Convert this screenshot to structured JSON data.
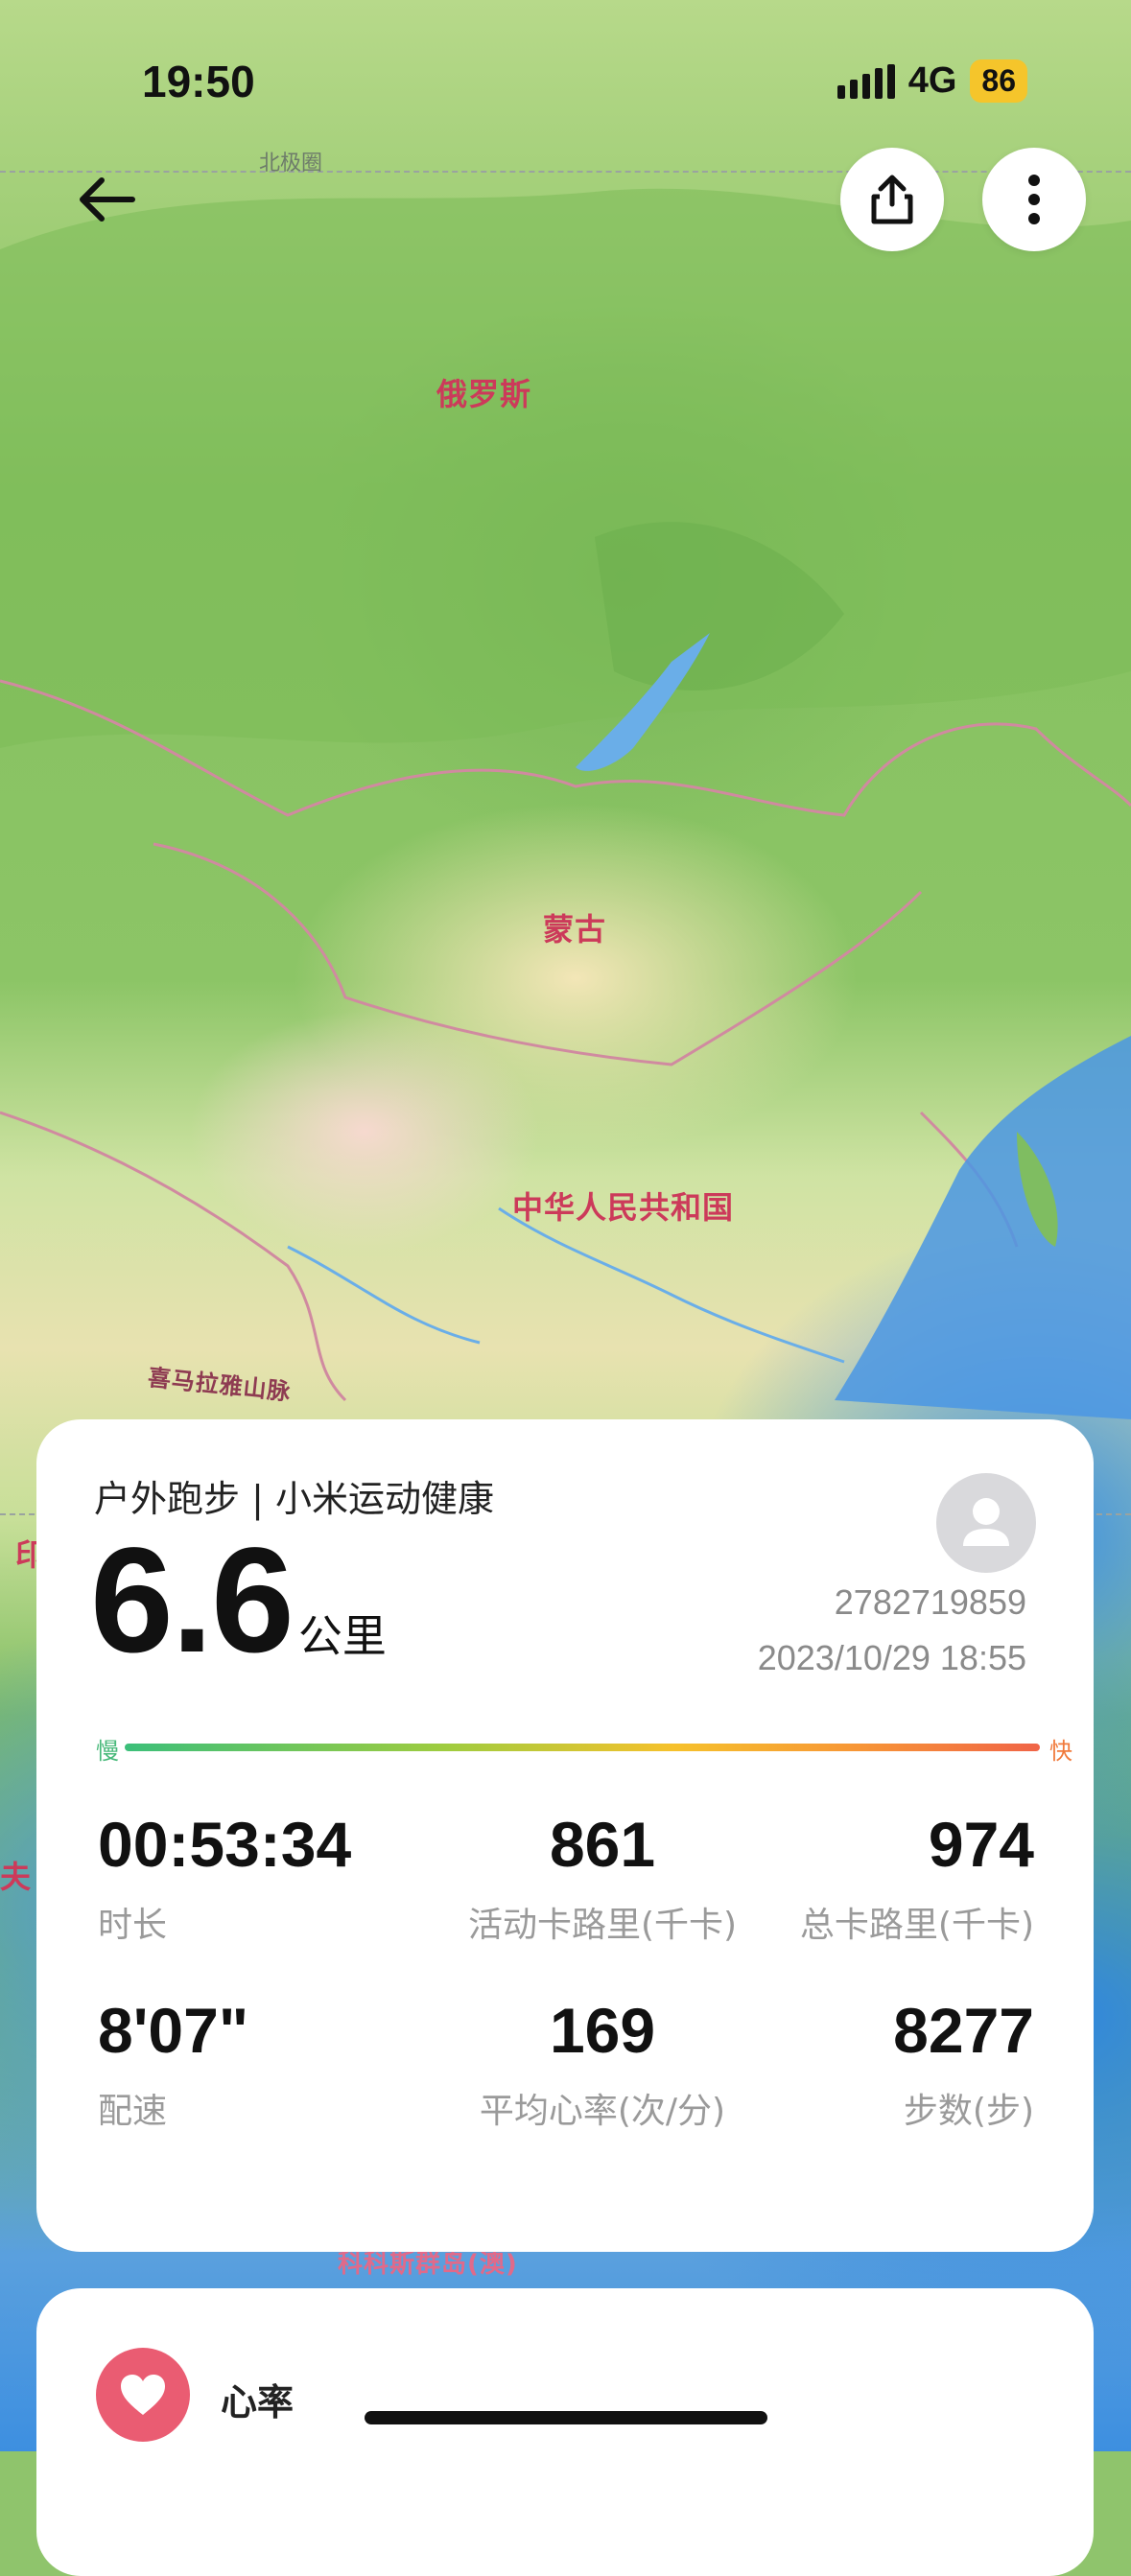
{
  "status_bar": {
    "time": "19:50",
    "network": "4G",
    "battery": "86"
  },
  "map": {
    "labels": {
      "arctic_circle": "北极圈",
      "russia": "俄罗斯",
      "mongolia": "蒙古",
      "china": "中华人民共和国",
      "himalaya": "喜马拉雅山脉",
      "india_partial": "印",
      "left_partial": "夫",
      "cocos": "科科斯群岛(澳)"
    }
  },
  "toolbar": {
    "back": "back-arrow-icon",
    "share": "share-icon",
    "more": "more-vertical-icon"
  },
  "summary": {
    "sport_title": "户外跑步 | 小米运动健康",
    "distance_value": "6.6",
    "distance_unit": "公里",
    "user_id": "2782719859",
    "datetime": "2023/10/29 18:55",
    "pace_slow": "慢",
    "pace_fast": "快",
    "stats": [
      {
        "value": "00:53:34",
        "label": "时长"
      },
      {
        "value": "861",
        "label": "活动卡路里(千卡)"
      },
      {
        "value": "974",
        "label": "总卡路里(千卡)"
      },
      {
        "value": "8'07\"",
        "label": "配速"
      },
      {
        "value": "169",
        "label": "平均心率(次/分)"
      },
      {
        "value": "8277",
        "label": "步数(步)"
      }
    ]
  },
  "heart_rate": {
    "title": "心率"
  },
  "colors": {
    "heart": "#ea5c72",
    "pace_slow": "#48b97a",
    "pace_fast": "#f07a3c",
    "battery": "#f5c52b"
  }
}
